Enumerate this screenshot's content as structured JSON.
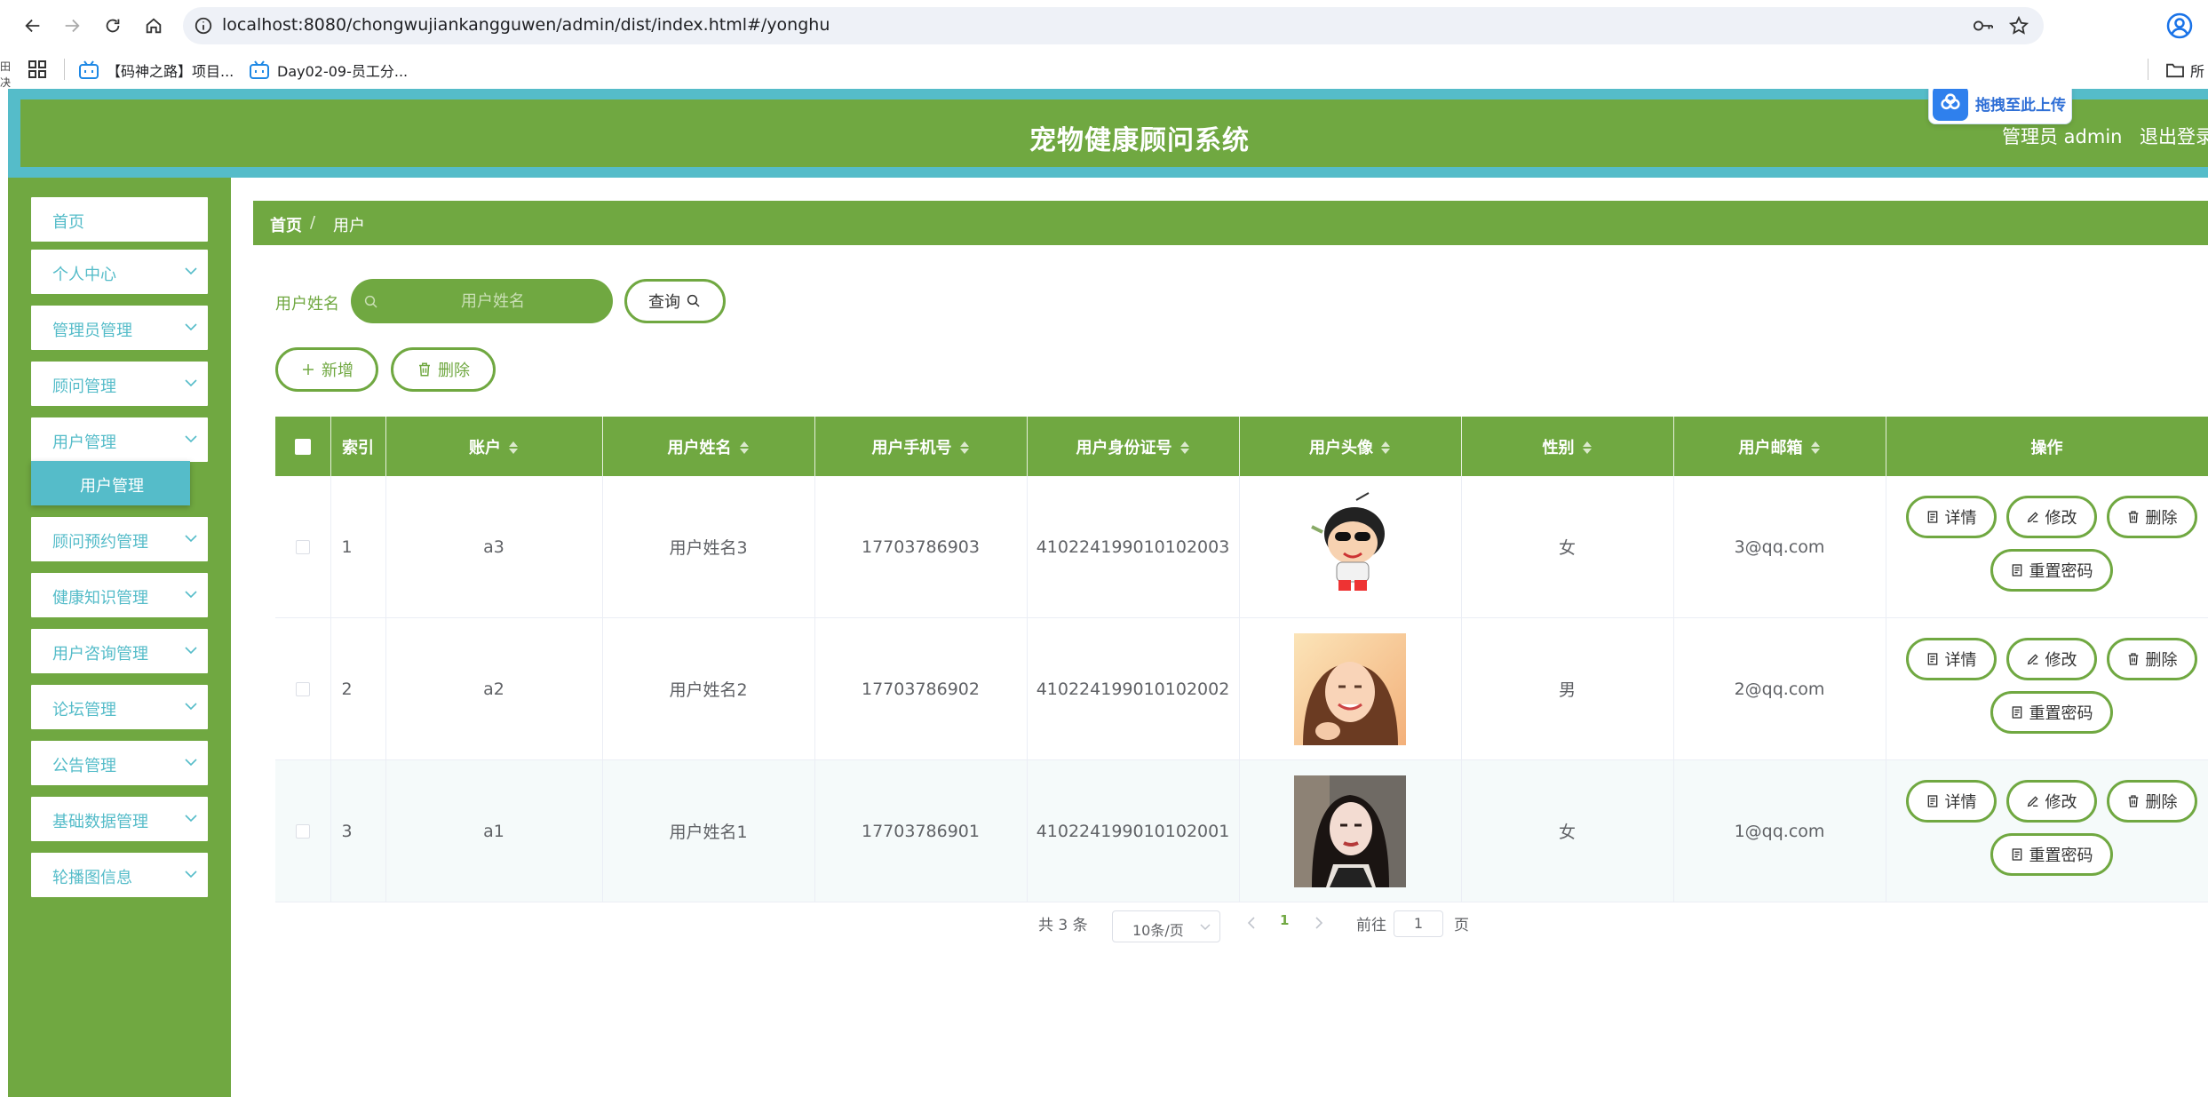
{
  "browser": {
    "url": "localhost:8080/chongwujiankangguwen/admin/dist/index.html#/yonghu",
    "bookmarks": [
      "【码神之路】项目...",
      "Day02-09-员工分..."
    ],
    "all_bookmarks_label": "所",
    "left_glyphs": [
      "田",
      "决"
    ]
  },
  "header": {
    "title": "宠物健康顾问系统",
    "admin_label": "管理员 admin",
    "logout_label": "退出登录",
    "upload_widget_label": "拖拽至此上传"
  },
  "sidebar": {
    "items": [
      {
        "label": "首页",
        "has_chevron": false
      },
      {
        "label": "个人中心",
        "has_chevron": true
      },
      {
        "label": "管理员管理",
        "has_chevron": true
      },
      {
        "label": "顾问管理",
        "has_chevron": true
      },
      {
        "label": "用户管理",
        "has_chevron": true
      },
      {
        "label": "顾问预约管理",
        "has_chevron": true
      },
      {
        "label": "健康知识管理",
        "has_chevron": true
      },
      {
        "label": "用户咨询管理",
        "has_chevron": true
      },
      {
        "label": "论坛管理",
        "has_chevron": true
      },
      {
        "label": "公告管理",
        "has_chevron": true
      },
      {
        "label": "基础数据管理",
        "has_chevron": true
      },
      {
        "label": "轮播图信息",
        "has_chevron": true
      }
    ],
    "submenu_label": "用户管理"
  },
  "breadcrumb": {
    "home": "首页",
    "separator": "/",
    "current": "用户"
  },
  "search": {
    "label": "用户姓名",
    "placeholder": "用户姓名",
    "value": "",
    "query_button": "查询"
  },
  "actions": {
    "add": "新增",
    "delete": "删除"
  },
  "table": {
    "columns": [
      "索引",
      "账户",
      "用户姓名",
      "用户手机号",
      "用户身份证号",
      "用户头像",
      "性别",
      "用户邮箱",
      "操作"
    ],
    "rows": [
      {
        "index": "1",
        "account": "a3",
        "name": "用户姓名3",
        "phone": "17703786903",
        "id_card": "410224199010102003",
        "avatar": "cartoon-boy-avatar",
        "gender": "女",
        "email": "3@qq.com"
      },
      {
        "index": "2",
        "account": "a2",
        "name": "用户姓名2",
        "phone": "17703786902",
        "id_card": "410224199010102002",
        "avatar": "smiling-woman-photo",
        "gender": "男",
        "email": "2@qq.com"
      },
      {
        "index": "3",
        "account": "a1",
        "name": "用户姓名1",
        "phone": "17703786901",
        "id_card": "410224199010102001",
        "avatar": "woman-portrait-photo",
        "gender": "女",
        "email": "1@qq.com"
      }
    ],
    "row_actions": {
      "detail": "详情",
      "edit": "修改",
      "delete": "删除",
      "reset_password": "重置密码"
    }
  },
  "pagination": {
    "total_text": "共 3 条",
    "page_size": "10条/页",
    "current_page": "1",
    "goto_label": "前往",
    "goto_value": "1",
    "page_suffix": "页"
  },
  "colors": {
    "primary_green": "#70a841",
    "accent_teal": "#55bcc9"
  }
}
